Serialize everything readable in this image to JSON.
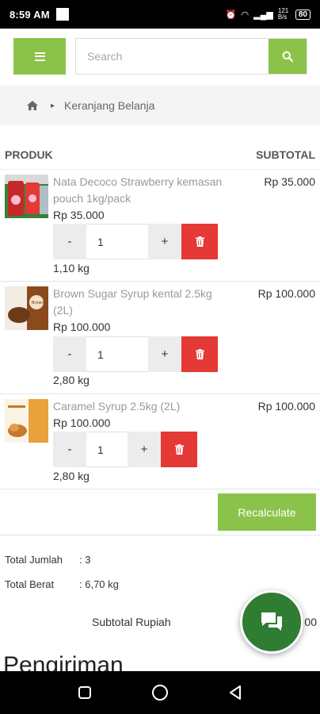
{
  "status_bar": {
    "time": "8:59 AM",
    "network": "121 B/s",
    "battery": "80"
  },
  "header": {
    "search_placeholder": "Search"
  },
  "breadcrumb": {
    "current": "Keranjang Belanja"
  },
  "table": {
    "col_product": "PRODUK",
    "col_subtotal": "SUBTOTAL"
  },
  "items": [
    {
      "name": "Nata Decoco Strawberry kemasan pouch 1kg/pack",
      "price": "Rp 35.000",
      "subtotal": "Rp 35.000",
      "qty": "1",
      "weight": "1,10 kg"
    },
    {
      "name": "Brown Sugar Syrup kental 2.5kg (2L)",
      "price": "Rp 100.000",
      "subtotal": "Rp 100.000",
      "qty": "1",
      "weight": "2,80 kg"
    },
    {
      "name": "Caramel Syrup 2.5kg (2L)",
      "price": "Rp 100.000",
      "subtotal": "Rp 100.000",
      "qty": "1",
      "weight": "2,80 kg"
    }
  ],
  "qty_controls": {
    "minus": "-",
    "plus": "+"
  },
  "recalculate_label": "Recalculate",
  "totals": {
    "count_label": "Total Jumlah",
    "count_value": ": 3",
    "weight_label": "Total Berat",
    "weight_value": ": 6,70 kg",
    "subtotal_label": "Subtotal Rupiah",
    "subtotal_value_partial": "00"
  },
  "shipping_title": "Pengiriman",
  "colors": {
    "accent_green": "#8bc34a",
    "delete_red": "#e53935",
    "fab_green": "#2e7d32"
  }
}
